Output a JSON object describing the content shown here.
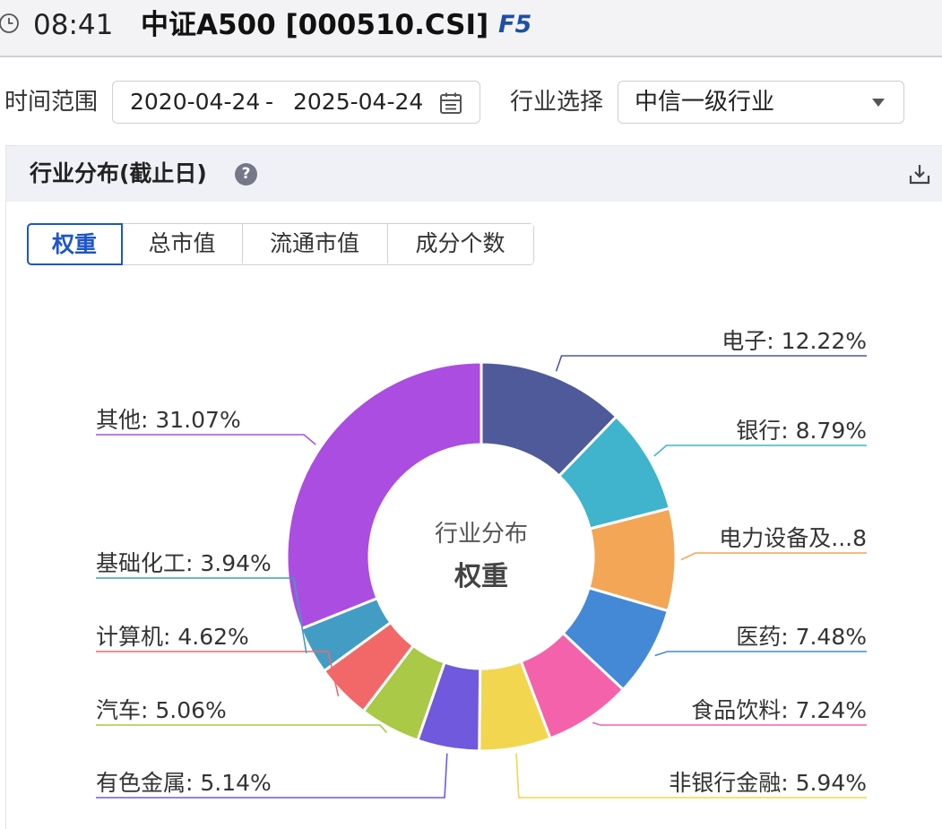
{
  "header": {
    "time": "08:41",
    "title": "中证A500 [000510.CSI]",
    "hotkey": "F5"
  },
  "filters": {
    "range_label": "时间范围",
    "start_date": "2020-04-24",
    "separator": "-",
    "end_date": "2025-04-24",
    "industry_label": "行业选择",
    "industry_value": "中信一级行业"
  },
  "panel": {
    "title": "行业分布(截止日)",
    "help": "?",
    "tabs": [
      {
        "label": "权重",
        "active": true
      },
      {
        "label": "总市值",
        "active": false
      },
      {
        "label": "流通市值",
        "active": false
      },
      {
        "label": "成分个数",
        "active": false
      }
    ]
  },
  "chart_data": {
    "type": "pie",
    "center_title": "行业分布",
    "center_value": "权重",
    "slices": [
      {
        "name": "电子",
        "value": 12.22,
        "label": "电子: 12.22%",
        "color": "#4f5a9a"
      },
      {
        "name": "银行",
        "value": 8.79,
        "label": "银行: 8.79%",
        "color": "#3fb4cc"
      },
      {
        "name": "电力设备及新能源",
        "value": 8.5,
        "label": "电力设备及...8",
        "color": "#f2a656"
      },
      {
        "name": "医药",
        "value": 7.48,
        "label": "医药: 7.48%",
        "color": "#4489d6"
      },
      {
        "name": "食品饮料",
        "value": 7.24,
        "label": "食品饮料: 7.24%",
        "color": "#f462ac"
      },
      {
        "name": "非银行金融",
        "value": 5.94,
        "label": "非银行金融: 5.94%",
        "color": "#f2d650"
      },
      {
        "name": "有色金属",
        "value": 5.14,
        "label": "有色金属: 5.14%",
        "color": "#7059dc"
      },
      {
        "name": "汽车",
        "value": 5.06,
        "label": "汽车: 5.06%",
        "color": "#a9c947"
      },
      {
        "name": "计算机",
        "value": 4.62,
        "label": "计算机: 4.62%",
        "color": "#f26868"
      },
      {
        "name": "基础化工",
        "value": 3.94,
        "label": "基础化工: 3.94%",
        "color": "#439cc4"
      },
      {
        "name": "其他",
        "value": 31.07,
        "label": "其他: 31.07%",
        "color": "#ab4de0"
      }
    ]
  }
}
